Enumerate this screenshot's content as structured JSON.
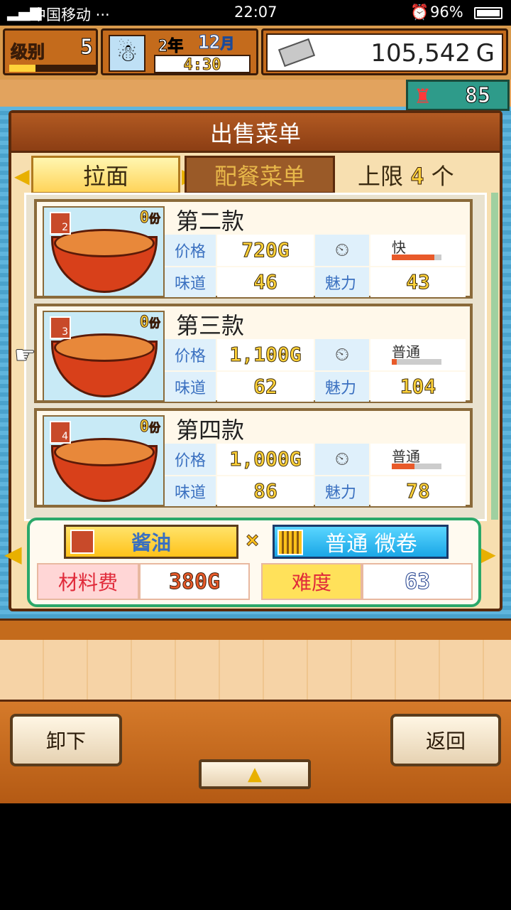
{
  "status": {
    "carrier": "中国移动 ···",
    "time": "22:07",
    "battery": "96%"
  },
  "hud": {
    "level_label": "级别",
    "level_value": "5",
    "level_progress": 0.3,
    "year": "2",
    "year_unit": "年",
    "month": "12",
    "month_unit": "月",
    "clock": "4:30",
    "money": "105,542",
    "money_unit": "G",
    "staff_count": "85"
  },
  "panel": {
    "title": "出售菜单",
    "tab_ramen": "拉面",
    "tab_set": "配餐菜单",
    "limit_prefix": "上限",
    "limit_value": "4",
    "limit_suffix": "个"
  },
  "labels": {
    "price": "价格",
    "taste": "味道",
    "charm": "魅力"
  },
  "items": [
    {
      "name": "第二款",
      "rank": "2",
      "sold": "0",
      "sold_unit": "份",
      "price": "720G",
      "speed": "快",
      "speed_level": 0.85,
      "taste": "46",
      "charm": "43"
    },
    {
      "name": "第三款",
      "rank": "3",
      "sold": "0",
      "sold_unit": "份",
      "price": "1,100G",
      "speed": "普通",
      "speed_level": 0.1,
      "taste": "62",
      "charm": "104"
    },
    {
      "name": "第四款",
      "rank": "4",
      "sold": "0",
      "sold_unit": "份",
      "price": "1,000G",
      "speed": "普通",
      "speed_level": 0.45,
      "taste": "86",
      "charm": "78"
    }
  ],
  "recipe": {
    "soup": "酱油",
    "times": "×",
    "noodle": "普通 微卷",
    "cost_label": "材料费",
    "cost_value": "380G",
    "difficulty_label": "难度",
    "difficulty_value": "63"
  },
  "buttons": {
    "unload": "卸下",
    "back": "返回"
  }
}
